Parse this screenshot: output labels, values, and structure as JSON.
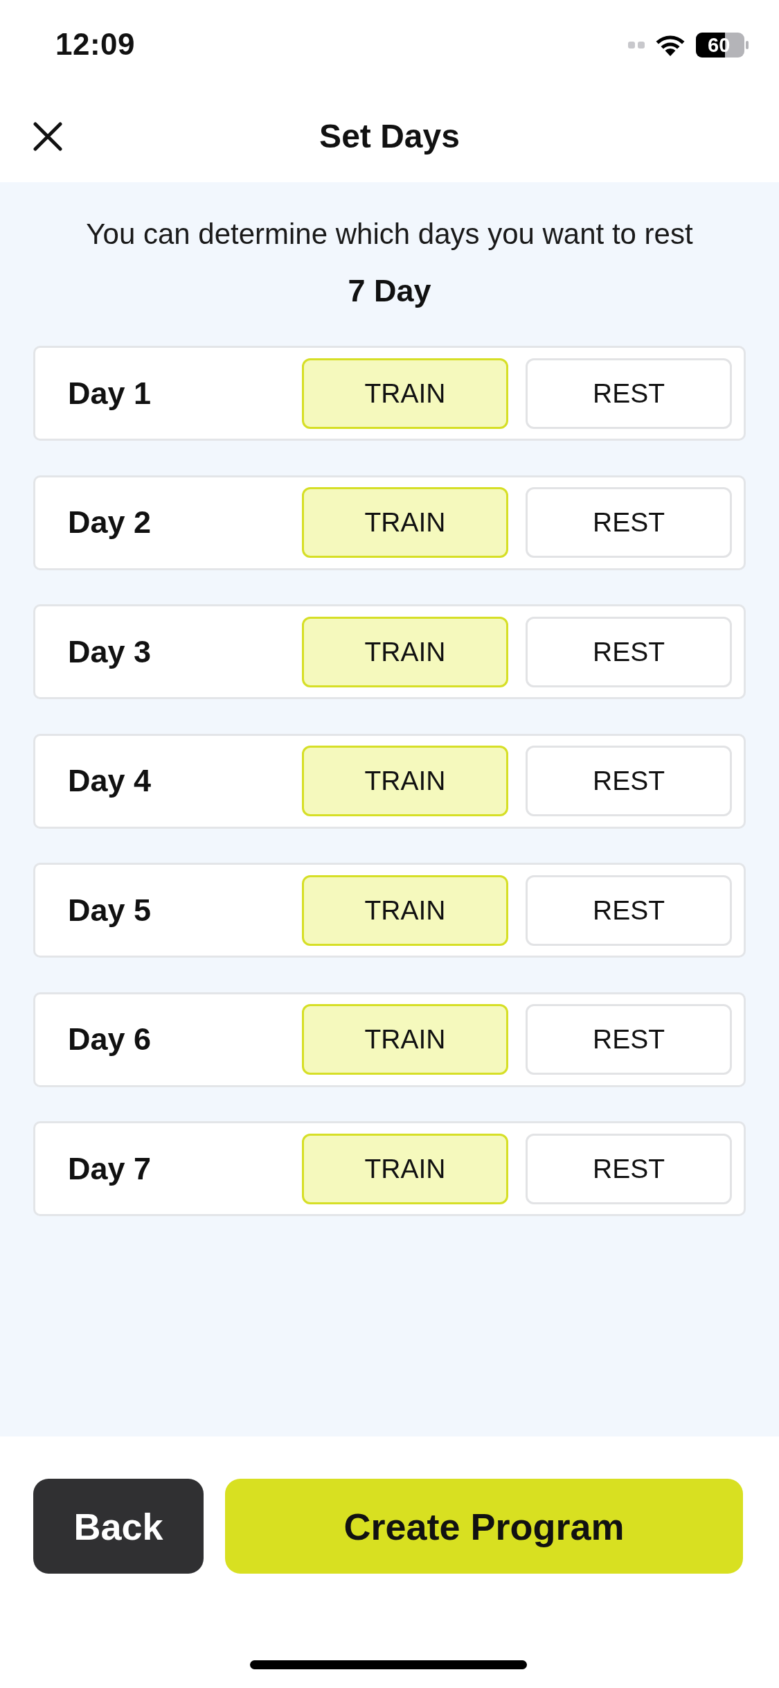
{
  "status_bar": {
    "time": "12:09",
    "battery": "60"
  },
  "header": {
    "title": "Set Days"
  },
  "intro": {
    "text": "You can determine which days you want to rest",
    "count": "7 Day"
  },
  "days": [
    {
      "label": "Day 1",
      "options": [
        {
          "label": "TRAIN",
          "selected": true
        },
        {
          "label": "REST",
          "selected": false
        }
      ]
    },
    {
      "label": "Day 2",
      "options": [
        {
          "label": "TRAIN",
          "selected": true
        },
        {
          "label": "REST",
          "selected": false
        }
      ]
    },
    {
      "label": "Day 3",
      "options": [
        {
          "label": "TRAIN",
          "selected": true
        },
        {
          "label": "REST",
          "selected": false
        }
      ]
    },
    {
      "label": "Day 4",
      "options": [
        {
          "label": "TRAIN",
          "selected": true
        },
        {
          "label": "REST",
          "selected": false
        }
      ]
    },
    {
      "label": "Day 5",
      "options": [
        {
          "label": "TRAIN",
          "selected": true
        },
        {
          "label": "REST",
          "selected": false
        }
      ]
    },
    {
      "label": "Day 6",
      "options": [
        {
          "label": "TRAIN",
          "selected": true
        },
        {
          "label": "REST",
          "selected": false
        }
      ]
    },
    {
      "label": "Day 7",
      "options": [
        {
          "label": "TRAIN",
          "selected": true
        },
        {
          "label": "REST",
          "selected": false
        }
      ]
    }
  ],
  "footer": {
    "buttons": [
      {
        "label": "Back",
        "kind": "secondary"
      },
      {
        "label": "Create Program",
        "kind": "primary"
      }
    ]
  }
}
